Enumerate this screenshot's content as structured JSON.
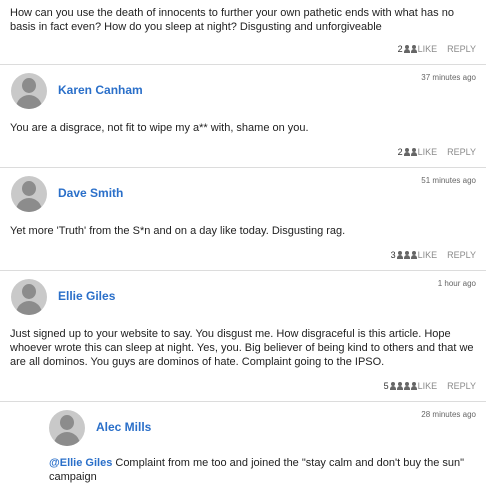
{
  "top_comment": {
    "text": "How can you use the death of innocents to further your own pathetic ends with what has no basis in fact even?  How do you sleep at night?  Disgusting and unforgiveable",
    "like_count": "2",
    "like_label": "LIKE",
    "reply_label": "REPLY"
  },
  "comments": [
    {
      "author": "Karen Canham",
      "time": "37 minutes ago",
      "text": "You are a disgrace, not fit to wipe my a** with, shame on you.",
      "like_count": "2",
      "like_label": "LIKE",
      "reply_label": "REPLY"
    },
    {
      "author": "Dave Smith",
      "time": "51 minutes ago",
      "text": "Yet more 'Truth' from the S*n and on a day like today. Disgusting rag.",
      "like_count": "3",
      "like_label": "LIKE",
      "reply_label": "REPLY"
    },
    {
      "author": "Ellie Giles",
      "time": "1 hour ago",
      "text": "Just signed up to your website to say. You disgust me. How disgraceful is this article. Hope whoever wrote this can sleep at night. Yes, you. Big believer of being kind to others and that we are all dominos. You guys are dominos of hate. Complaint going to the IPSO.",
      "like_count": "5",
      "like_label": "LIKE",
      "reply_label": "REPLY"
    }
  ],
  "reply": {
    "author": "Alec Mills",
    "time": "28 minutes ago",
    "mention": "@Ellie Giles",
    "text": " Complaint from me too and joined the \"stay calm and don't buy the sun\" campaign"
  }
}
